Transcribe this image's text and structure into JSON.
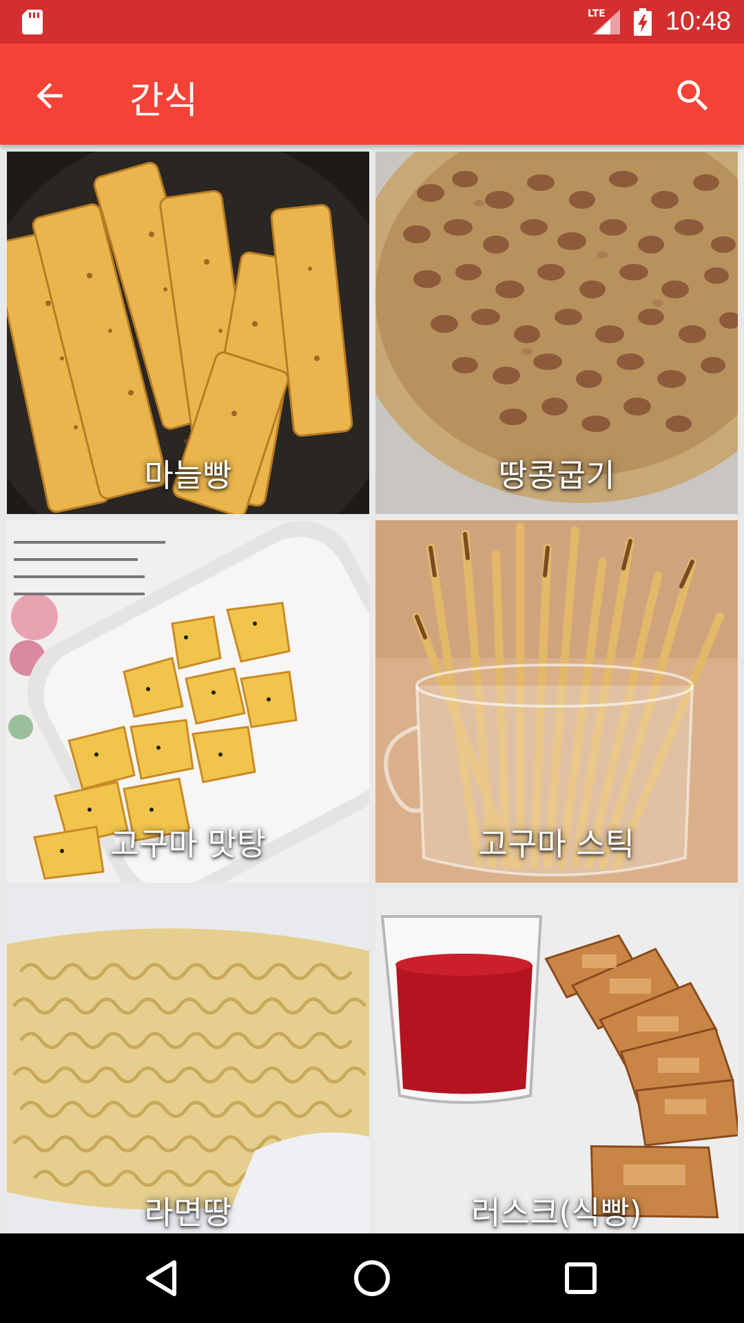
{
  "status_bar": {
    "time": "10:48",
    "network": "LTE",
    "icons": [
      "sd-card-icon",
      "signal-icon",
      "battery-charging-icon"
    ]
  },
  "app_bar": {
    "title": "간식",
    "back_icon": "arrow-back-icon",
    "search_icon": "search-icon"
  },
  "items": [
    {
      "label": "마늘빵"
    },
    {
      "label": "땅콩굽기"
    },
    {
      "label": "고구마 맛탕"
    },
    {
      "label": "고구마 스틱"
    },
    {
      "label": "라면땅"
    },
    {
      "label": "러스크(식빵)"
    }
  ],
  "nav_bar": {
    "icons": [
      "back-triangle-icon",
      "home-circle-icon",
      "recents-square-icon"
    ]
  },
  "colors": {
    "status_bar": "#d32f2f",
    "app_bar": "#f44336",
    "nav_bar": "#000000"
  }
}
